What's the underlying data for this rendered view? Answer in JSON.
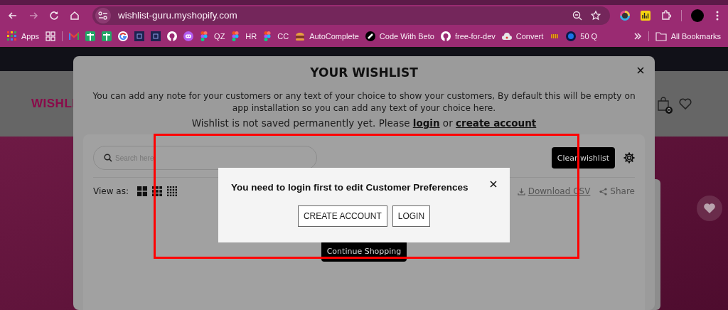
{
  "browser": {
    "url": "wishlist-guru.myshopify.com"
  },
  "bookmarks": [
    {
      "kind": "apps",
      "label": "Apps"
    },
    {
      "kind": "grid"
    },
    {
      "kind": "separator"
    },
    {
      "kind": "mail"
    },
    {
      "kind": "sheet"
    },
    {
      "kind": "sheet"
    },
    {
      "kind": "g-logo"
    },
    {
      "kind": "chip"
    },
    {
      "kind": "chip"
    },
    {
      "kind": "octocat"
    },
    {
      "kind": "bot"
    },
    {
      "kind": "figma",
      "label": "QZ"
    },
    {
      "kind": "figma",
      "label": "HR"
    },
    {
      "kind": "figma",
      "label": "CC"
    },
    {
      "kind": "burger",
      "label": "AutoComplete"
    },
    {
      "kind": "ring",
      "label": "Code With Beto"
    },
    {
      "kind": "octocat",
      "label": "free-for-dev"
    },
    {
      "kind": "cloud",
      "label": "Convert"
    },
    {
      "kind": "candy"
    },
    {
      "kind": "b-circle",
      "label": "50 Q"
    }
  ],
  "all_bookmarks": "All Bookmarks",
  "store": {
    "logo": "WISHLI",
    "cart_count": "0"
  },
  "wishlist_modal": {
    "title": "YOUR WISHLIST",
    "note": "You can add any note for your customers or any text of your choice to show your customers, By default this will be empty on app installation so you can add any text of your choice here.",
    "notice": [
      {
        "kind": "text",
        "text": "Wishlist is not saved permanently yet. Please "
      },
      {
        "kind": "link",
        "text": "login"
      },
      {
        "kind": "text",
        "text": " or "
      },
      {
        "kind": "link",
        "text": "create account"
      }
    ],
    "search_placeholder": "Search here",
    "clear_button": "Clear wishlist",
    "view_label": "View as:",
    "view_options": [
      {
        "kind": "large"
      },
      {
        "kind": "medium"
      },
      {
        "kind": "small"
      }
    ],
    "download": "Download CSV",
    "share": "Share",
    "continue_button": "Continue Shopping"
  },
  "login_dialog": {
    "message": "You need to login first to edit Customer Preferences",
    "buttons": [
      "CREATE ACCOUNT",
      "LOGIN"
    ]
  },
  "highlight": {
    "kind": "rectangle"
  }
}
